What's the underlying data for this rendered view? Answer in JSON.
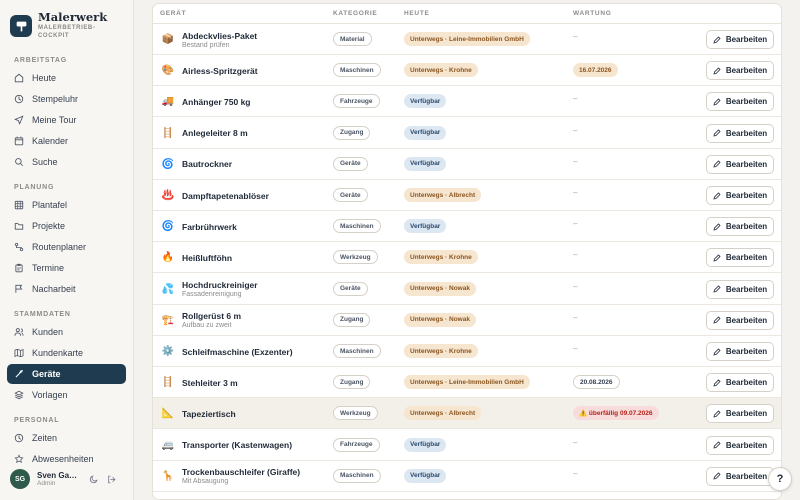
{
  "brand": {
    "name": "Malerwerk",
    "subtitle": "MALERBETRIEB-COCKPIT"
  },
  "sidebar": {
    "sections": [
      {
        "label": "ARBEITSTAG",
        "items": [
          {
            "label": "Heute",
            "icon": "home-icon"
          },
          {
            "label": "Stempeluhr",
            "icon": "clock-icon"
          },
          {
            "label": "Meine Tour",
            "icon": "navigation-icon"
          },
          {
            "label": "Kalender",
            "icon": "calendar-icon"
          },
          {
            "label": "Suche",
            "icon": "search-icon"
          }
        ]
      },
      {
        "label": "PLANUNG",
        "items": [
          {
            "label": "Plantafel",
            "icon": "grid-icon"
          },
          {
            "label": "Projekte",
            "icon": "folder-icon"
          },
          {
            "label": "Routenplaner",
            "icon": "route-icon"
          },
          {
            "label": "Termine",
            "icon": "clipboard-icon"
          },
          {
            "label": "Nacharbeit",
            "icon": "flag-icon"
          }
        ]
      },
      {
        "label": "STAMMDATEN",
        "items": [
          {
            "label": "Kunden",
            "icon": "users-icon"
          },
          {
            "label": "Kundenkarte",
            "icon": "map-icon"
          },
          {
            "label": "Geräte",
            "icon": "tool-icon",
            "active": true
          },
          {
            "label": "Vorlagen",
            "icon": "layers-icon"
          }
        ]
      },
      {
        "label": "PERSONAL",
        "items": [
          {
            "label": "Zeiten",
            "icon": "clock-icon"
          },
          {
            "label": "Abwesenheiten",
            "icon": "star-icon"
          }
        ]
      }
    ]
  },
  "user": {
    "initials": "SG",
    "name": "Sven Ga…",
    "role": "Admin"
  },
  "table": {
    "headers": {
      "device": "GERÄT",
      "category": "KATEGORIE",
      "today": "HEUTE",
      "maintenance": "WARTUNG"
    },
    "edit_label": "Bearbeiten",
    "rows": [
      {
        "icon": "📦",
        "name": "Abdeckvlies-Paket",
        "sub": "Bestand prüfen",
        "category": "Material",
        "status": "Unterwegs · Leine-Immobilien GmbH",
        "status_type": "away",
        "maintenance": "–",
        "maint_type": "none"
      },
      {
        "icon": "🎨",
        "name": "Airless-Spritzgerät",
        "sub": "",
        "category": "Maschinen",
        "status": "Unterwegs · Krohne",
        "status_type": "away",
        "maintenance": "16.07.2026",
        "maint_type": "warn"
      },
      {
        "icon": "🚚",
        "name": "Anhänger 750 kg",
        "sub": "",
        "category": "Fahrzeuge",
        "status": "Verfügbar",
        "status_type": "free",
        "maintenance": "–",
        "maint_type": "none"
      },
      {
        "icon": "🪜",
        "name": "Anlegeleiter 8 m",
        "sub": "",
        "category": "Zugang",
        "status": "Verfügbar",
        "status_type": "free",
        "maintenance": "–",
        "maint_type": "none"
      },
      {
        "icon": "🌀",
        "name": "Bautrockner",
        "sub": "",
        "category": "Geräte",
        "status": "Verfügbar",
        "status_type": "free",
        "maintenance": "–",
        "maint_type": "none"
      },
      {
        "icon": "♨️",
        "name": "Dampftapetenablöser",
        "sub": "",
        "category": "Geräte",
        "status": "Unterwegs · Albrecht",
        "status_type": "away",
        "maintenance": "–",
        "maint_type": "none"
      },
      {
        "icon": "🌀",
        "name": "Farbrührwerk",
        "sub": "",
        "category": "Maschinen",
        "status": "Verfügbar",
        "status_type": "free",
        "maintenance": "–",
        "maint_type": "none"
      },
      {
        "icon": "🔥",
        "name": "Heißluftföhn",
        "sub": "",
        "category": "Werkzeug",
        "status": "Unterwegs · Krohne",
        "status_type": "away",
        "maintenance": "–",
        "maint_type": "none"
      },
      {
        "icon": "💦",
        "name": "Hochdruckreiniger",
        "sub": "Fassadenreinigung",
        "category": "Geräte",
        "status": "Unterwegs · Nowak",
        "status_type": "away",
        "maintenance": "–",
        "maint_type": "none"
      },
      {
        "icon": "🏗️",
        "name": "Rollgerüst 6 m",
        "sub": "Aufbau zu zweit",
        "category": "Zugang",
        "status": "Unterwegs · Nowak",
        "status_type": "away",
        "maintenance": "–",
        "maint_type": "none"
      },
      {
        "icon": "⚙️",
        "name": "Schleifmaschine (Exzenter)",
        "sub": "",
        "category": "Maschinen",
        "status": "Unterwegs · Krohne",
        "status_type": "away",
        "maintenance": "–",
        "maint_type": "none"
      },
      {
        "icon": "🪜",
        "name": "Stehleiter 3 m",
        "sub": "",
        "category": "Zugang",
        "status": "Unterwegs · Leine-Immobilien GmbH",
        "status_type": "away",
        "maintenance": "20.08.2026",
        "maint_type": "neutral"
      },
      {
        "icon": "📐",
        "name": "Tapeziertisch",
        "sub": "",
        "category": "Werkzeug",
        "status": "Unterwegs · Albrecht",
        "status_type": "away",
        "maintenance": "⚠️ überfällig 09.07.2026",
        "maint_type": "over",
        "highlight": true
      },
      {
        "icon": "🚐",
        "name": "Transporter (Kastenwagen)",
        "sub": "",
        "category": "Fahrzeuge",
        "status": "Verfügbar",
        "status_type": "free",
        "maintenance": "–",
        "maint_type": "none"
      },
      {
        "icon": "🦒",
        "name": "Trockenbauschleifer (Giraffe)",
        "sub": "Mit Absaugung",
        "category": "Maschinen",
        "status": "Verfügbar",
        "status_type": "free",
        "maintenance": "–",
        "maint_type": "none"
      }
    ]
  },
  "help": {
    "label": "?"
  }
}
